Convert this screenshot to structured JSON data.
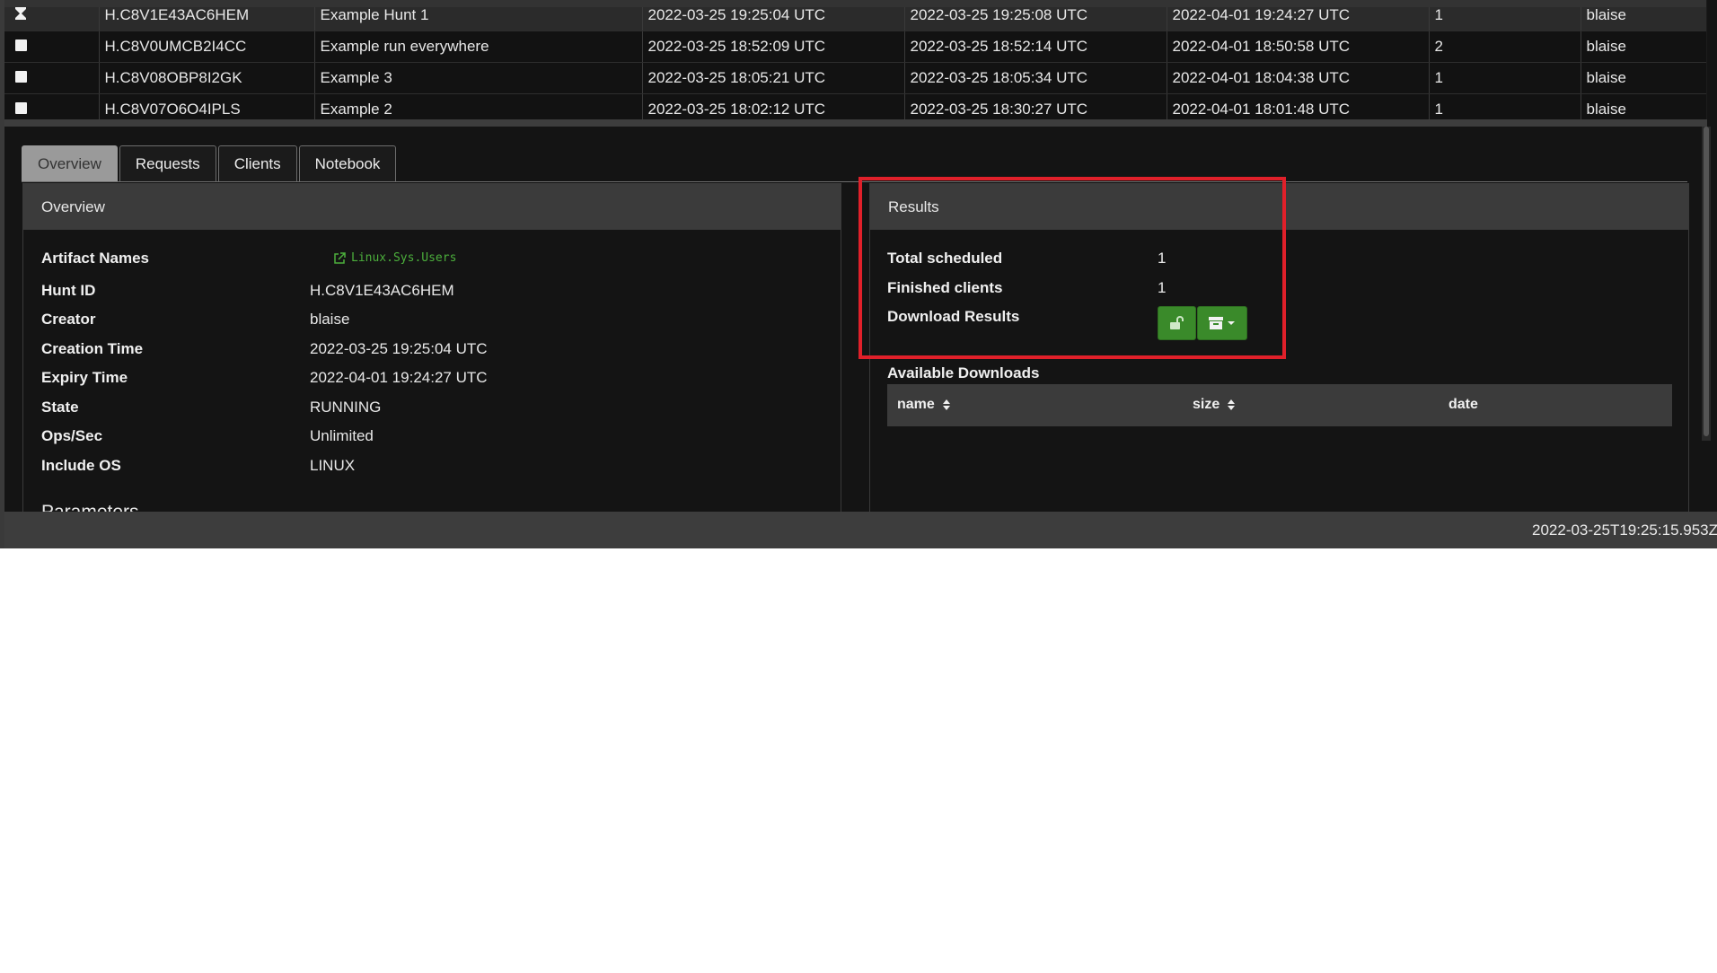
{
  "hunts_table": {
    "rows": [
      {
        "icon": "hourglass-icon",
        "id": "H.C8V1E43AC6HEM",
        "description": "Example Hunt 1",
        "created": "2022-03-25 19:25:04 UTC",
        "started": "2022-03-25 19:25:08 UTC",
        "expires": "2022-04-01 19:24:27 UTC",
        "scheduled": "1",
        "creator": "blaise"
      },
      {
        "icon": "stopped-square-icon",
        "id": "H.C8V0UMCB2I4CC",
        "description": "Example run everywhere",
        "created": "2022-03-25 18:52:09 UTC",
        "started": "2022-03-25 18:52:14 UTC",
        "expires": "2022-04-01 18:50:58 UTC",
        "scheduled": "2",
        "creator": "blaise"
      },
      {
        "icon": "stopped-square-icon",
        "id": "H.C8V08OBP8I2GK",
        "description": "Example 3",
        "created": "2022-03-25 18:05:21 UTC",
        "started": "2022-03-25 18:05:34 UTC",
        "expires": "2022-04-01 18:04:38 UTC",
        "scheduled": "1",
        "creator": "blaise"
      },
      {
        "icon": "stopped-square-icon",
        "id": "H.C8V07O6O4IPLS",
        "description": "Example 2",
        "created": "2022-03-25 18:02:12 UTC",
        "started": "2022-03-25 18:30:27 UTC",
        "expires": "2022-04-01 18:01:48 UTC",
        "scheduled": "1",
        "creator": "blaise"
      }
    ]
  },
  "tabs": [
    "Overview",
    "Requests",
    "Clients",
    "Notebook"
  ],
  "overview": {
    "title": "Overview",
    "labels": {
      "artifact_names": "Artifact Names",
      "hunt_id": "Hunt ID",
      "creator": "Creator",
      "creation_time": "Creation Time",
      "expiry_time": "Expiry Time",
      "state": "State",
      "ops_sec": "Ops/Sec",
      "include_os": "Include OS"
    },
    "values": {
      "artifact_names": "Linux.Sys.Users",
      "hunt_id": "H.C8V1E43AC6HEM",
      "creator": "blaise",
      "creation_time": "2022-03-25 19:25:04 UTC",
      "expiry_time": "2022-04-01 19:24:27 UTC",
      "state": "RUNNING",
      "ops_sec": "Unlimited",
      "include_os": "LINUX"
    },
    "parameters_label": "Parameters"
  },
  "results": {
    "title": "Results",
    "labels": {
      "total_scheduled": "Total scheduled",
      "finished_clients": "Finished clients",
      "download_results": "Download Results"
    },
    "values": {
      "total_scheduled": "1",
      "finished_clients": "1"
    },
    "available_downloads_label": "Available Downloads",
    "downloads_columns": [
      "name",
      "size",
      "date"
    ]
  },
  "status_bar": {
    "timestamp": "2022-03-25T19:25:15.953Z"
  },
  "colors": {
    "highlight": "#e0202a",
    "button_green": "#3a8a2a",
    "link_green": "#4caf3c"
  }
}
